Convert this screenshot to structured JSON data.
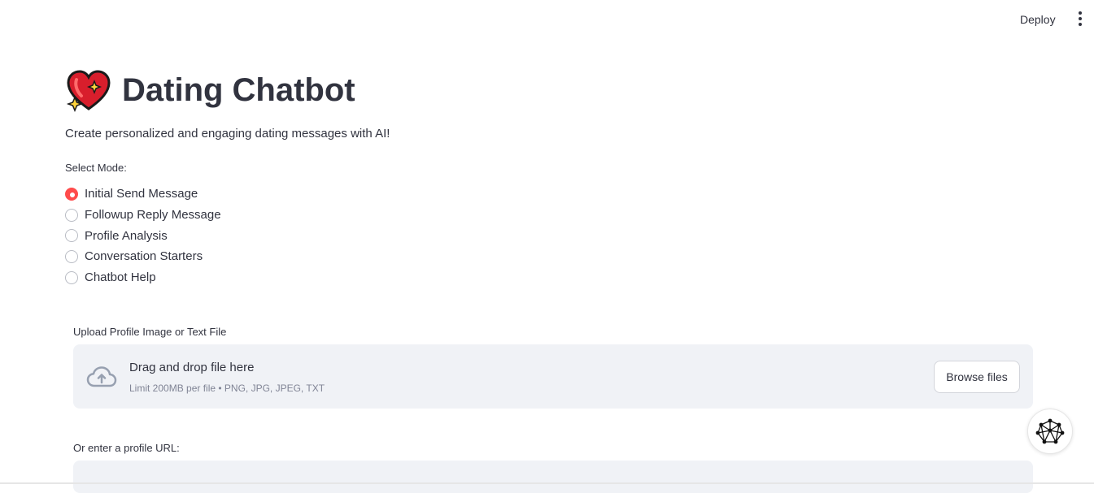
{
  "header": {
    "deploy_label": "Deploy",
    "menu_icon": "kebab-menu-icon"
  },
  "main": {
    "title": "Dating Chatbot",
    "title_icon": "sparkling-heart-icon",
    "subtitle": "Create personalized and engaging dating messages with AI!",
    "mode": {
      "label": "Select Mode:",
      "selected_index": 0,
      "options": [
        "Initial Send Message",
        "Followup Reply Message",
        "Profile Analysis",
        "Conversation Starters",
        "Chatbot Help"
      ]
    },
    "upload": {
      "label": "Upload Profile Image or Text File",
      "drop_title": "Drag and drop file here",
      "limit_text": "Limit 200MB per file • PNG, JPG, JPEG, TXT",
      "browse_label": "Browse files",
      "icon": "cloud-upload-icon"
    },
    "url": {
      "label": "Or enter a profile URL:",
      "value": "",
      "placeholder": ""
    }
  },
  "fab_icon": "network-graph-icon",
  "colors": {
    "accent": "#ff4b4b",
    "text": "#31333f",
    "muted": "#808495",
    "input_bg": "#f0f2f6"
  }
}
